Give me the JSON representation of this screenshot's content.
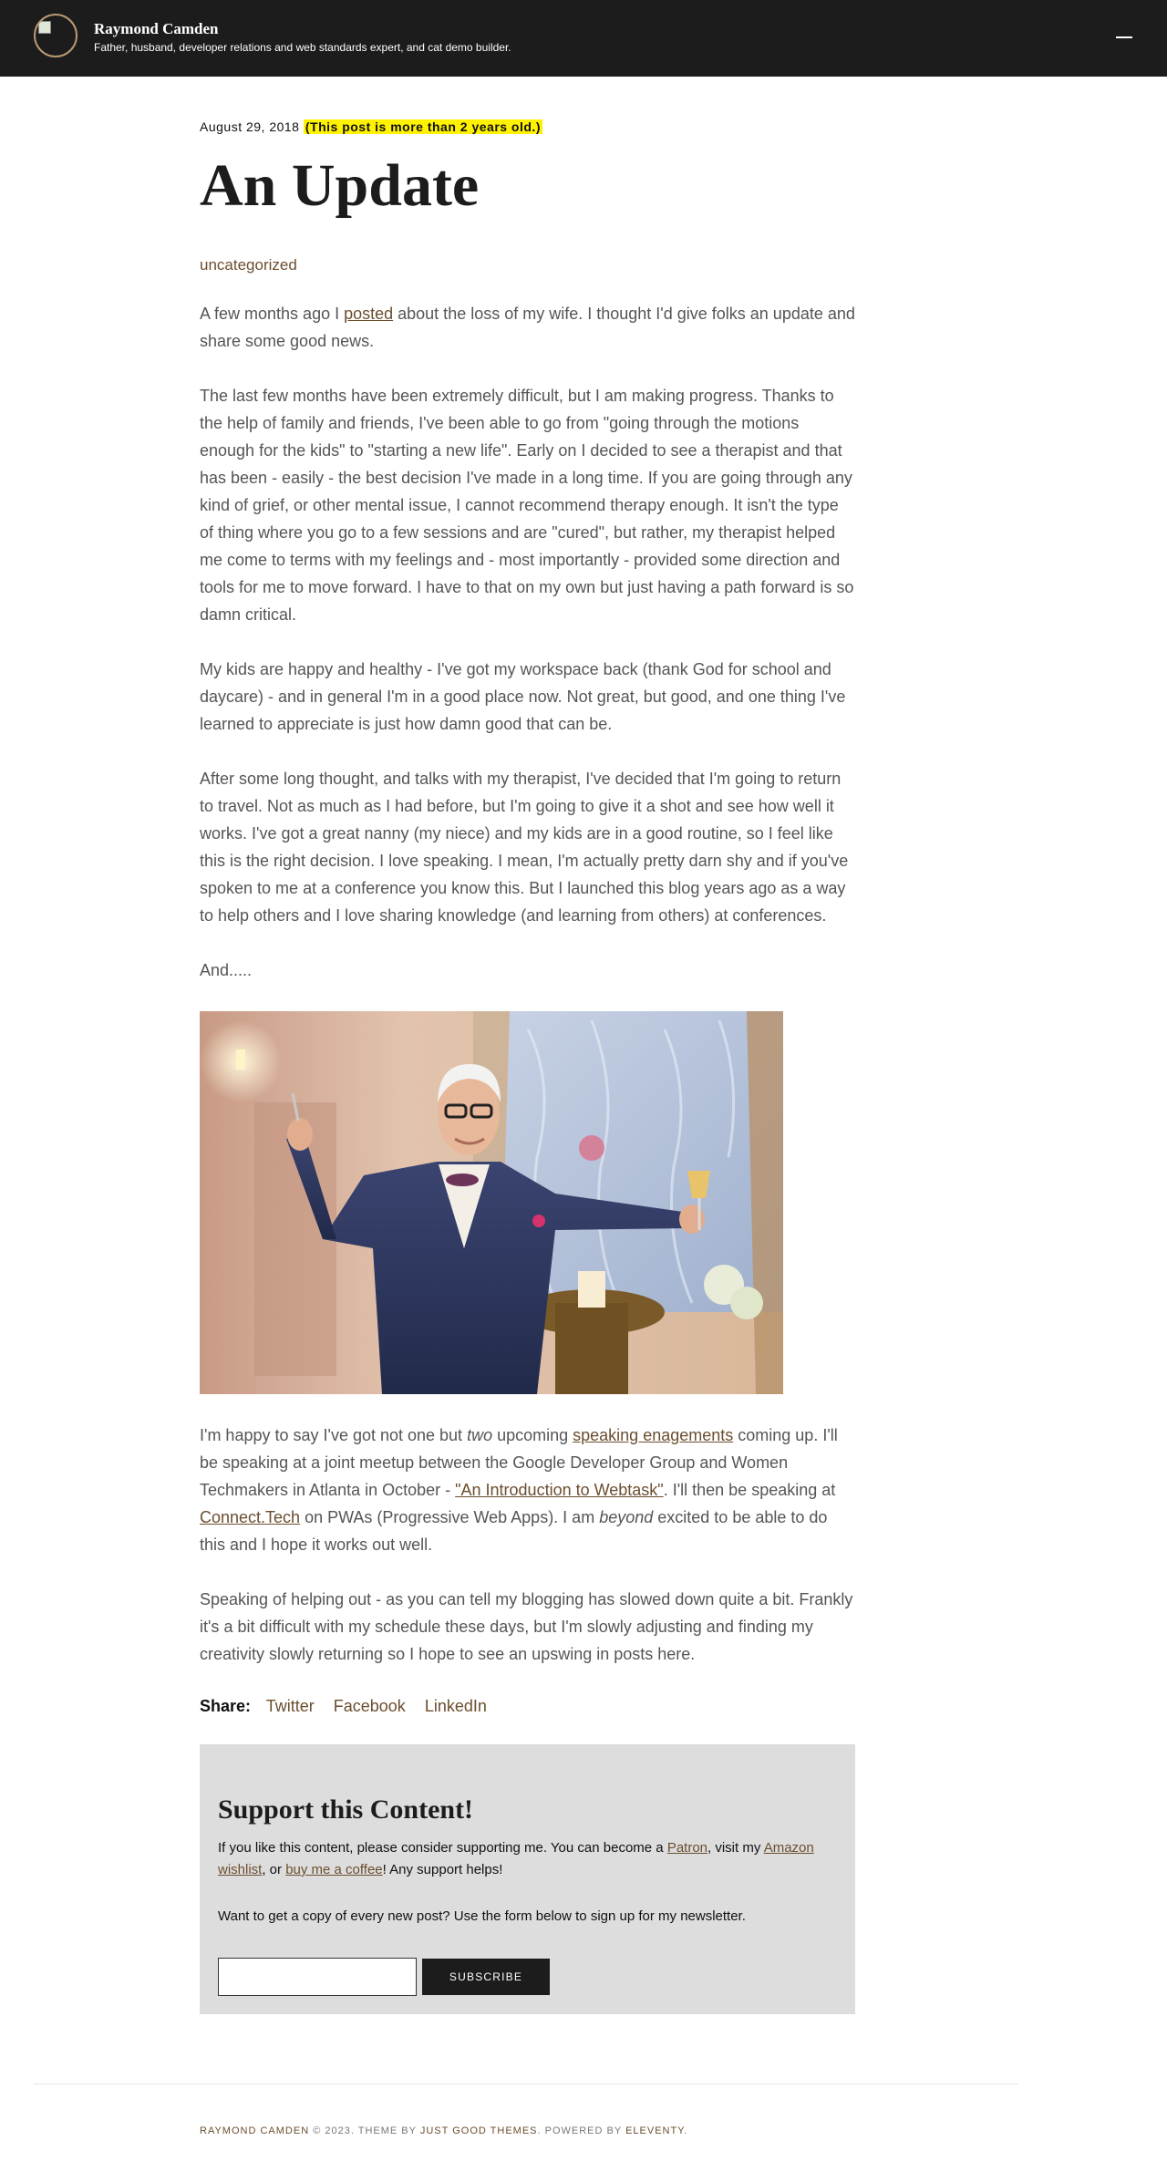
{
  "header": {
    "site_name": "Raymond Camden",
    "tagline": "Father, husband, developer relations and web standards expert, and cat demo builder.",
    "menu_icon": "hamburger-icon"
  },
  "post": {
    "date": "August 29, 2018",
    "age_notice": "(This post is more than 2 years old.)",
    "title": "An Update",
    "category": "uncategorized",
    "p1": {
      "t1": "A few months ago I ",
      "link": "posted",
      "t2": " about the loss of my wife. I thought I'd give folks an update and share some good news."
    },
    "p2": "The last few months have been extremely difficult, but I am making progress. Thanks to the help of family and friends, I've been able to go from \"going through the motions enough for the kids\" to \"starting a new life\". Early on I decided to see a therapist and that has been - easily - the best decision I've made in a long time. If you are going through any kind of grief, or other mental issue, I cannot recommend therapy enough. It isn't the type of thing where you go to a few sessions and are \"cured\", but rather, my therapist helped me come to terms with my feelings and - most importantly - provided some direction and tools for me to move forward. I have to that on my own but just having a path forward is so damn critical.",
    "p3": "My kids are happy and healthy - I've got my workspace back (thank God for school and daycare) - and in general I'm in a good place now. Not great, but good, and one thing I've learned to appreciate is just how damn good that can be.",
    "p4": "After some long thought, and talks with my therapist, I've decided that I'm going to return to travel. Not as much as I had before, but I'm going to give it a shot and see how well it works. I've got a great nanny (my niece) and my kids are in a good routine, so I feel like this is the right decision. I love speaking. I mean, I'm actually pretty darn shy and if you've spoken to me at a conference you know this. But I launched this blog years ago as a way to help others and I love sharing knowledge (and learning from others) at conferences.",
    "p5": "And.....",
    "p6": {
      "t1": "I'm happy to say I've got not one but ",
      "em1": "two",
      "t2": " upcoming ",
      "link1": "speaking enagements",
      "t3": " coming up. I'll be speaking at a joint meetup between the Google Developer Group and Women Techmakers in Atlanta in October - ",
      "link2": "\"An Introduction to Webtask\"",
      "t4": ". I'll then be speaking at ",
      "link3": "Connect.Tech",
      "t5": " on PWAs (Progressive Web Apps). I am ",
      "em2": "beyond",
      "t6": " excited to be able to do this and I hope it works out well."
    },
    "p7": "Speaking of helping out - as you can tell my blogging has slowed down quite a bit. Frankly it's a bit difficult with my schedule these days, but I'm slowly adjusting and finding my creativity slowly returning so I hope to see an upswing in posts here."
  },
  "share": {
    "label": "Share:",
    "links": [
      "Twitter",
      "Facebook",
      "LinkedIn"
    ]
  },
  "support": {
    "heading": "Support this Content!",
    "s1": {
      "t1": "If you like this content, please consider supporting me. You can become a ",
      "link1": "Patron",
      "t2": ", visit my ",
      "link2": "Amazon wishlist",
      "t3": ", or ",
      "link3": "buy me a coffee",
      "t4": "! Any support helps!"
    },
    "s2": "Want to get a copy of every new post? Use the form below to sign up for my newsletter.",
    "email_value": "",
    "button_label": "SUBSCRIBE"
  },
  "footer": {
    "author": "Raymond Camden",
    "t1": " © 2023. Theme by ",
    "theme": "Just Good Themes",
    "t2": ". Powered by ",
    "engine": "Eleventy",
    "t3": "."
  },
  "colors": {
    "header_bg": "#1c1c1c",
    "link": "#6b4e2e",
    "highlight": "#fff200",
    "support_bg": "#dddddd"
  }
}
